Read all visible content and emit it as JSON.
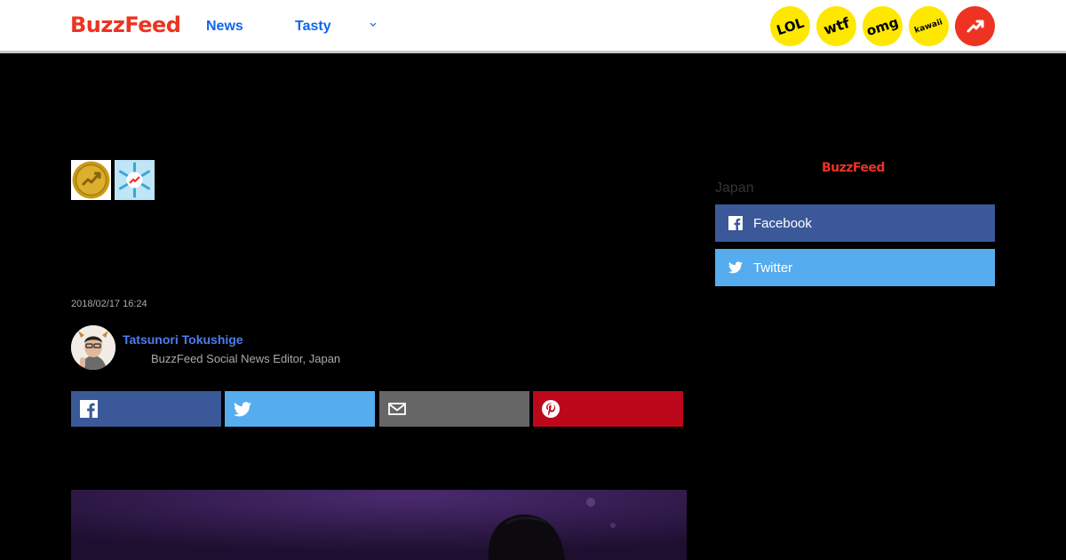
{
  "header": {
    "logo": "BuzzFeed",
    "nav": [
      "News",
      "Tasty"
    ],
    "badges": [
      "LOL",
      "wtf",
      "omg",
      "kawaii"
    ],
    "trending_icon": "trending-arrow-icon",
    "colors": {
      "brand": "#ee3322",
      "link": "#0f65ef",
      "badge": "#fee800"
    }
  },
  "sidebar": {
    "logo": "BuzzFeed",
    "label": "Japan",
    "buttons": [
      {
        "label": "Facebook",
        "icon": "facebook-icon",
        "color": "#3b5998"
      },
      {
        "label": "Twitter",
        "icon": "twitter-icon",
        "color": "#55acee"
      }
    ]
  },
  "article": {
    "awards": [
      "gold-trending-award-icon",
      "snowflake-trending-award-icon"
    ],
    "timestamp": "2018/02/17 16:24",
    "author": {
      "name": "Tatsunori Tokushige",
      "role": "BuzzFeed Social News Editor, Japan"
    },
    "share_buttons": [
      {
        "icon": "facebook-icon",
        "color": "#3b5998"
      },
      {
        "icon": "twitter-icon",
        "color": "#55acee"
      },
      {
        "icon": "email-icon",
        "color": "#666666"
      },
      {
        "icon": "pinterest-icon",
        "color": "#bd081c"
      }
    ]
  }
}
